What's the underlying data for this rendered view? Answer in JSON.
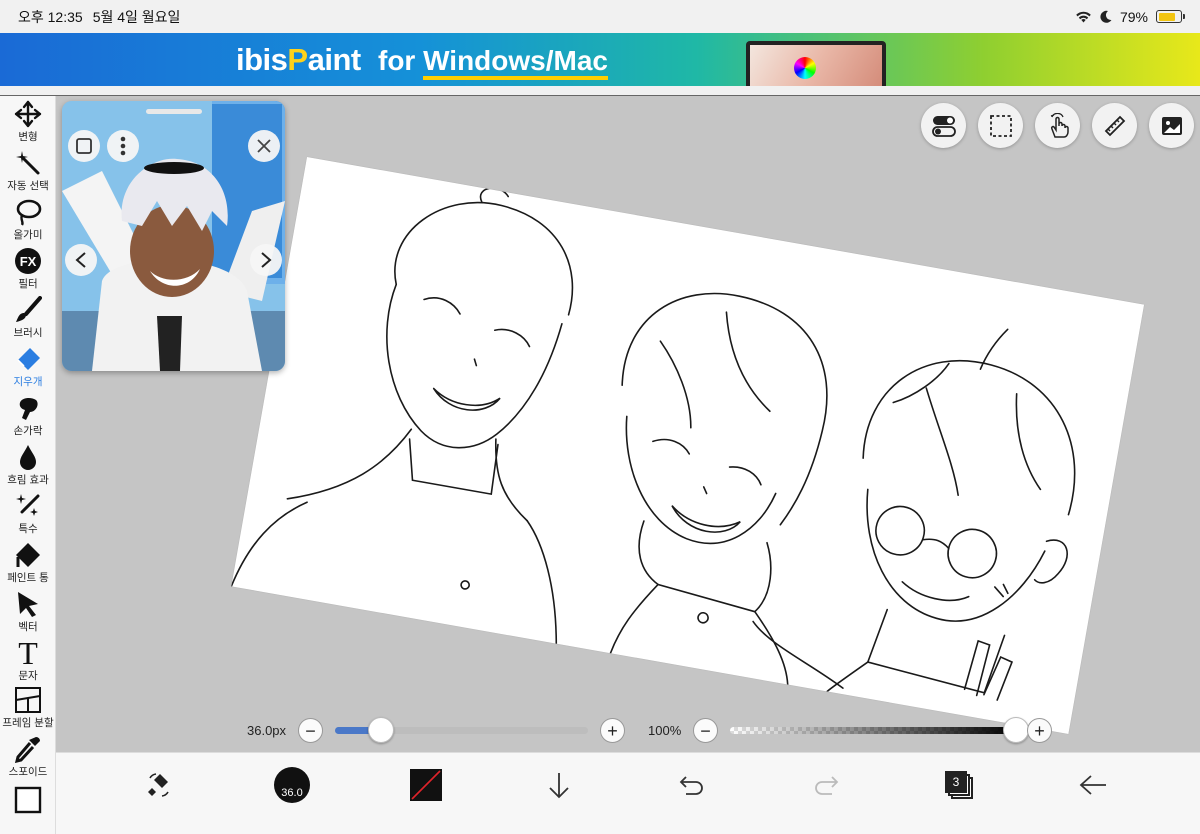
{
  "status": {
    "time": "오후 12:35",
    "date": "5월 4일 월요일",
    "battery": "79%",
    "battery_level": 0.79
  },
  "banner": {
    "logo_ibis": "ibis",
    "logo_paint_p": "P",
    "logo_paint_rest": "aint",
    "tagline_for": "for ",
    "tagline_rest": "Windows/Mac"
  },
  "tools": [
    {
      "label": "변형",
      "icon": "move-arrows-icon"
    },
    {
      "label": "자동 선택",
      "icon": "magic-wand-icon"
    },
    {
      "label": "올가미",
      "icon": "lasso-icon"
    },
    {
      "label": "필터",
      "icon": "fx-icon",
      "icon_text": "FX"
    },
    {
      "label": "브러시",
      "icon": "brush-icon"
    },
    {
      "label": "지우개",
      "icon": "eraser-icon",
      "active": true
    },
    {
      "label": "손가락",
      "icon": "smudge-finger-icon"
    },
    {
      "label": "흐림 효과",
      "icon": "blur-drop-icon"
    },
    {
      "label": "특수",
      "icon": "special-sparkle-icon"
    },
    {
      "label": "페인트 통",
      "icon": "paint-bucket-icon"
    },
    {
      "label": "벡터",
      "icon": "vector-cursor-icon"
    },
    {
      "label": "문자",
      "icon": "text-icon",
      "icon_text": "T"
    },
    {
      "label": "프레임 분할",
      "icon": "frame-divider-icon"
    },
    {
      "label": "스포이드",
      "icon": "eyedropper-icon"
    }
  ],
  "sliders": {
    "brush_size": "36.0px",
    "brush_size_fraction": 0.18,
    "opacity": "100%",
    "opacity_fraction": 1.0,
    "minus": "−",
    "plus": "+"
  },
  "bottom": {
    "brush_size_badge": "36.0",
    "layers_count": "3"
  },
  "colors": {
    "accent": "#2a7de1",
    "slider_fill": "#4a78c8"
  }
}
